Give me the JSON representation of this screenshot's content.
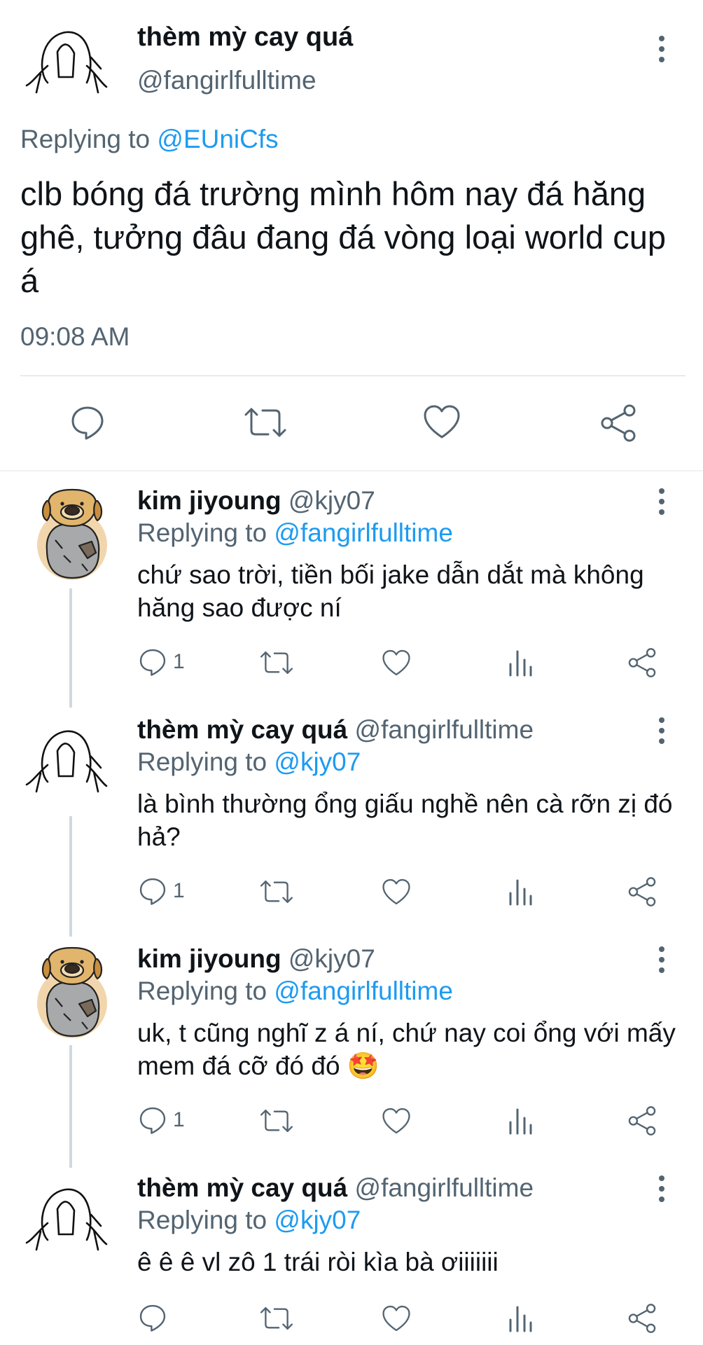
{
  "main_tweet": {
    "display_name": "thèm mỳ cay quá",
    "handle": "@fangirlfulltime",
    "replying_prefix": "Replying to",
    "replying_to": "@EUniCfs",
    "text": "clb bóng đá trường mình hôm nay đá hăng ghê, tưởng đâu đang đá vòng loại world cup á",
    "time": "09:08 AM"
  },
  "replies": [
    {
      "display_name": "kim jiyoung",
      "handle": "@kjy07",
      "replying_prefix": "Replying to",
      "replying_to": "@fangirlfulltime",
      "text": "chứ sao trời, tiền bối jake dẫn dắt mà không hăng sao được ní",
      "reply_count": "1"
    },
    {
      "display_name": "thèm mỳ cay quá",
      "handle": "@fangirlfulltime",
      "replying_prefix": "Replying to",
      "replying_to": "@kjy07",
      "text": "là bình thường ổng giấu nghề nên cà rỡn zị đó hả?",
      "reply_count": "1"
    },
    {
      "display_name": "kim jiyoung",
      "handle": "@kjy07",
      "replying_prefix": "Replying to",
      "replying_to": "@fangirlfulltime",
      "text": "uk, t cũng nghĩ z á ní, chứ nay coi ổng với mấy mem đá cỡ đó đó 🤩",
      "reply_count": "1"
    },
    {
      "display_name": "thèm mỳ cay quá",
      "handle": "@fangirlfulltime",
      "replying_prefix": "Replying to",
      "replying_to": "@kjy07",
      "text": "ê ê ê vl zô 1 trái ròi kìa bà ơiiiiiii",
      "reply_count": ""
    }
  ],
  "icons": {
    "reply": "speech-bubble-icon",
    "retweet": "retweet-arrows-icon",
    "like": "heart-icon",
    "views": "bar-chart-icon",
    "share": "share-icon",
    "more": "vertical-dots-icon"
  },
  "colors": {
    "link": "#1d9bf0",
    "secondary": "#536471",
    "text": "#0f1419"
  }
}
